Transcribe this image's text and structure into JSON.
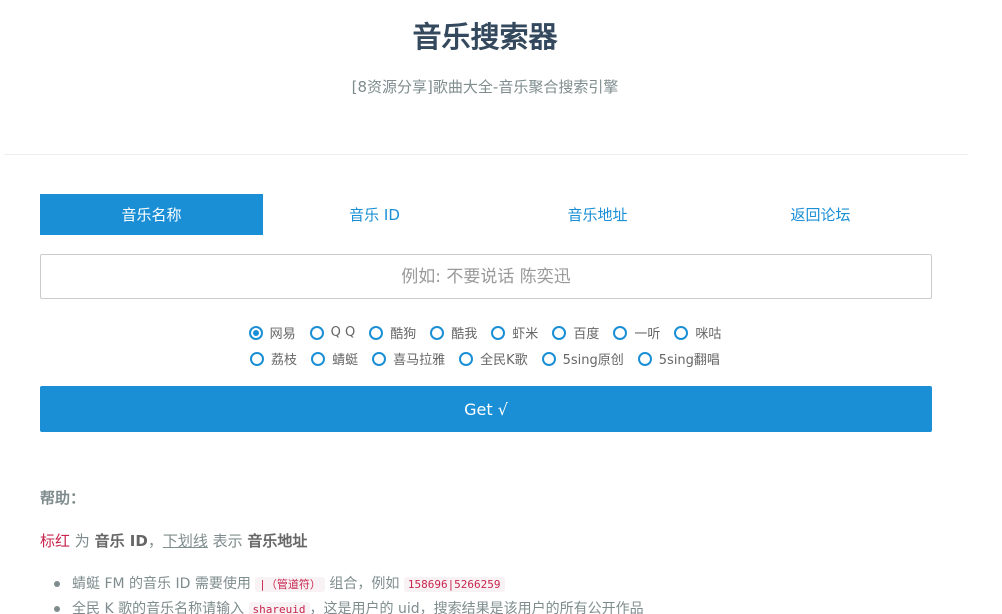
{
  "header": {
    "title": "音乐搜索器",
    "subtitle": "[8资源分享]歌曲大全-音乐聚合搜索引擎"
  },
  "tabs": [
    {
      "label": "音乐名称",
      "active": true
    },
    {
      "label": "音乐 ID",
      "active": false
    },
    {
      "label": "音乐地址",
      "active": false
    },
    {
      "label": "返回论坛",
      "active": false
    }
  ],
  "search": {
    "placeholder": "例如: 不要说话 陈奕迅",
    "value": ""
  },
  "sources": {
    "row1": [
      {
        "label": "网易",
        "checked": true
      },
      {
        "label": "Q Q",
        "checked": false
      },
      {
        "label": "酷狗",
        "checked": false
      },
      {
        "label": "酷我",
        "checked": false
      },
      {
        "label": "虾米",
        "checked": false
      },
      {
        "label": "百度",
        "checked": false
      },
      {
        "label": "一听",
        "checked": false
      },
      {
        "label": "咪咕",
        "checked": false
      }
    ],
    "row2": [
      {
        "label": "荔枝",
        "checked": false
      },
      {
        "label": "蜻蜓",
        "checked": false
      },
      {
        "label": "喜马拉雅",
        "checked": false
      },
      {
        "label": "全民K歌",
        "checked": false
      },
      {
        "label": "5sing原创",
        "checked": false
      },
      {
        "label": "5sing翻唱",
        "checked": false
      }
    ]
  },
  "get_button": {
    "label": "Get √"
  },
  "help": {
    "title": "帮助：",
    "legend": {
      "red_label": "标红",
      "t1": " 为 ",
      "music_id": "音乐 ID",
      "t2": "，",
      "underline_label": "下划线",
      "t3": " 表示 ",
      "music_url": "音乐地址"
    },
    "items": [
      {
        "pre": "蜻蜓 FM 的音乐 ID 需要使用 ",
        "code1": "|（管道符）",
        "mid": " 组合，例如 ",
        "code2": "158696|5266259",
        "post": ""
      },
      {
        "pre": "全民 K 歌的音乐名称请输入 ",
        "code1": "shareuid",
        "mid": "，这是用户的 uid，搜索结果是该用户的所有公开作品",
        "code2": "",
        "post": ""
      }
    ]
  },
  "colors": {
    "accent": "#1a8fd6",
    "title": "#34495e",
    "muted": "#7f8c8d",
    "code_red": "#c7254e"
  }
}
